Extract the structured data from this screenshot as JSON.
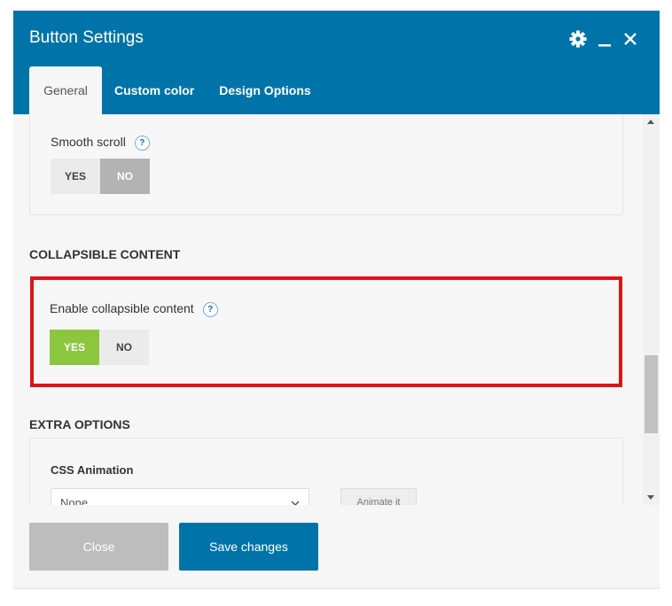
{
  "window": {
    "title": "Button Settings"
  },
  "header_icons": [
    "gear-icon",
    "minimize-icon",
    "close-icon"
  ],
  "tabs": [
    {
      "label": "General",
      "active": true
    },
    {
      "label": "Custom color",
      "active": false
    },
    {
      "label": "Design Options",
      "active": false
    }
  ],
  "smooth_scroll": {
    "label": "Smooth scroll",
    "help": "?",
    "yes": "YES",
    "no": "NO",
    "value": "NO"
  },
  "collapsible": {
    "section_title": "COLLAPSIBLE CONTENT",
    "label": "Enable collapsible content",
    "help": "?",
    "yes": "YES",
    "no": "NO",
    "value": "YES"
  },
  "extra_options": {
    "section_title": "EXTRA OPTIONS",
    "css_animation_label": "CSS Animation",
    "css_animation_value": "None",
    "animate_button": "Animate it"
  },
  "footer": {
    "close_label": "Close",
    "save_label": "Save changes"
  },
  "colors": {
    "header": "#0074a8",
    "toggle_active": "#8cc63f",
    "highlight": "#e01414"
  }
}
